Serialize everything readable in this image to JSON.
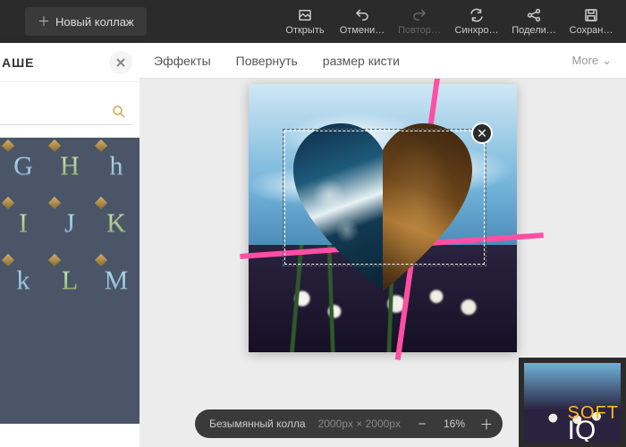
{
  "topbar": {
    "new_collage": "Новый коллаж",
    "actions": {
      "open": "Открыть",
      "undo": "Отмени…",
      "redo": "Повтор…",
      "sync": "Синхро…",
      "share": "Подели…",
      "save": "Сохран…"
    }
  },
  "sidepanel": {
    "title": "АШЕ",
    "search_placeholder": "",
    "letters": [
      "G",
      "H",
      "h",
      "I",
      "J",
      "K",
      "k",
      "L",
      "M"
    ]
  },
  "subbar": {
    "effects": "Эффекты",
    "rotate": "Повернуть",
    "brush": "размер кисти",
    "more": "More"
  },
  "canvas": {
    "selection_close": "✕"
  },
  "zoombar": {
    "doc_name": "Безымянный колла",
    "dimensions": "2000px × 2000px",
    "zoom": "16%"
  },
  "watermark": {
    "line1": "SOFT",
    "line2": "IQ"
  },
  "icons": {
    "plus": "＋",
    "search": "search-icon",
    "close": "close-icon",
    "chevron_down": "⌄",
    "minus": "−"
  }
}
